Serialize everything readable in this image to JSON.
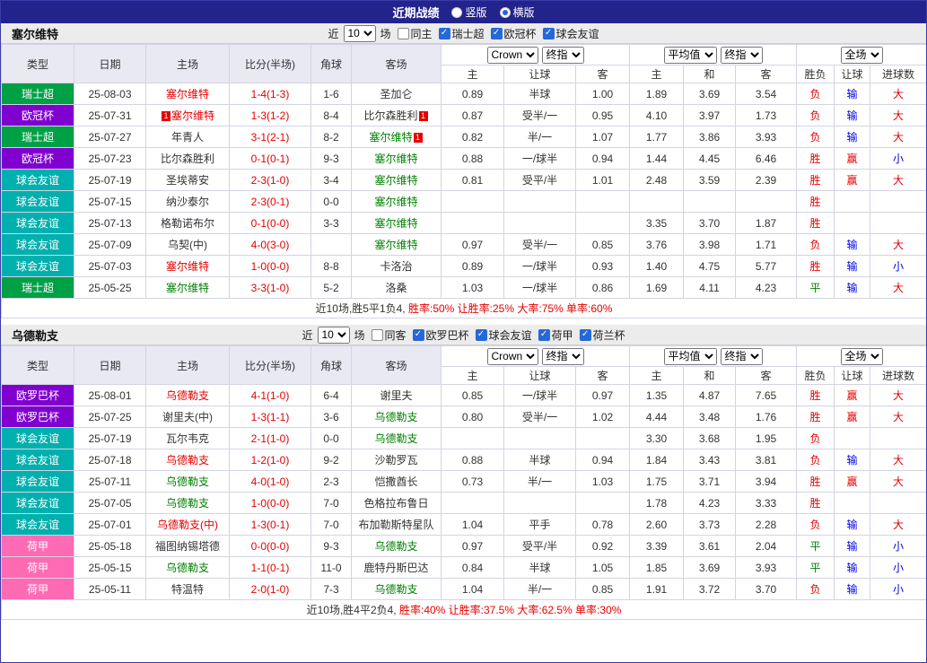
{
  "topbar": {
    "title": "近期战绩",
    "vertical_label": "竖版",
    "horizontal_label": "横版",
    "selected_label": "横版"
  },
  "filter_labels": {
    "near": "近",
    "games": "场"
  },
  "table_headers": {
    "type": "类型",
    "date": "日期",
    "home": "主场",
    "score": "比分(半场)",
    "corners": "角球",
    "away": "客场",
    "odds_header_groups": [
      {
        "selects": [
          "Crown",
          "终指"
        ]
      },
      {
        "selects": [
          "平均值",
          "终指"
        ]
      },
      {
        "selects": [
          "全场"
        ]
      }
    ],
    "sub_headers": [
      "主",
      "让球",
      "客",
      "主",
      "和",
      "客",
      "胜负",
      "让球",
      "进球数"
    ]
  },
  "league_colors": {
    "瑞士超": "#00a046",
    "欧冠杯": "#8000d0",
    "球会友谊": "#00b0ae",
    "欧罗巴杯": "#8000d0",
    "荷甲": "#ff6ab5"
  },
  "colors": {
    "red": "#e60000",
    "green": "#008000",
    "blue": "#0000e6",
    "black": "#333333"
  },
  "sections": [
    {
      "team": "塞尔维特",
      "filter": {
        "count": "10",
        "same": {
          "label": "同主",
          "checked": false
        },
        "leagues": [
          {
            "label": "瑞士超",
            "checked": true
          },
          {
            "label": "欧冠杯",
            "checked": true
          },
          {
            "label": "球会友谊",
            "checked": true
          }
        ]
      },
      "rows": [
        {
          "league": "瑞士超",
          "date": "25-08-03",
          "home": {
            "name": "塞尔维特",
            "color": "red"
          },
          "score": "1-4(1-3)",
          "corners": "1-6",
          "away": {
            "name": "圣加仑",
            "color": "black"
          },
          "ah": [
            "0.89",
            "半球",
            "1.00"
          ],
          "avg": [
            "1.89",
            "3.69",
            "3.54"
          ],
          "res": [
            [
              "负",
              "red"
            ],
            [
              "输",
              "blue"
            ],
            [
              "大",
              "red"
            ]
          ]
        },
        {
          "league": "欧冠杯",
          "date": "25-07-31",
          "home": {
            "name": "塞尔维特",
            "color": "red",
            "badge": "1",
            "badge_pos": "before"
          },
          "score": "1-3(1-2)",
          "corners": "8-4",
          "away": {
            "name": "比尔森胜利",
            "color": "black",
            "badge": "1",
            "badge_pos": "after"
          },
          "ah": [
            "0.87",
            "受半/一",
            "0.95"
          ],
          "avg": [
            "4.10",
            "3.97",
            "1.73"
          ],
          "res": [
            [
              "负",
              "red"
            ],
            [
              "输",
              "blue"
            ],
            [
              "大",
              "red"
            ]
          ]
        },
        {
          "league": "瑞士超",
          "date": "25-07-27",
          "home": {
            "name": "年青人",
            "color": "black"
          },
          "score": "3-1(2-1)",
          "corners": "8-2",
          "away": {
            "name": "塞尔维特",
            "color": "green",
            "badge": "1",
            "badge_pos": "after"
          },
          "ah": [
            "0.82",
            "半/一",
            "1.07"
          ],
          "avg": [
            "1.77",
            "3.86",
            "3.93"
          ],
          "res": [
            [
              "负",
              "red"
            ],
            [
              "输",
              "blue"
            ],
            [
              "大",
              "red"
            ]
          ]
        },
        {
          "league": "欧冠杯",
          "date": "25-07-23",
          "home": {
            "name": "比尔森胜利",
            "color": "black"
          },
          "score": "0-1(0-1)",
          "corners": "9-3",
          "away": {
            "name": "塞尔维特",
            "color": "green"
          },
          "ah": [
            "0.88",
            "一/球半",
            "0.94"
          ],
          "avg": [
            "1.44",
            "4.45",
            "6.46"
          ],
          "res": [
            [
              "胜",
              "red"
            ],
            [
              "赢",
              "red"
            ],
            [
              "小",
              "blue"
            ]
          ]
        },
        {
          "league": "球会友谊",
          "date": "25-07-19",
          "home": {
            "name": "圣埃蒂安",
            "color": "black"
          },
          "score": "2-3(1-0)",
          "corners": "3-4",
          "away": {
            "name": "塞尔维特",
            "color": "green"
          },
          "ah": [
            "0.81",
            "受平/半",
            "1.01"
          ],
          "avg": [
            "2.48",
            "3.59",
            "2.39"
          ],
          "res": [
            [
              "胜",
              "red"
            ],
            [
              "赢",
              "red"
            ],
            [
              "大",
              "red"
            ]
          ]
        },
        {
          "league": "球会友谊",
          "date": "25-07-15",
          "home": {
            "name": "纳沙泰尔",
            "color": "black"
          },
          "score": "2-3(0-1)",
          "corners": "0-0",
          "away": {
            "name": "塞尔维特",
            "color": "green"
          },
          "ah": [
            "",
            "",
            ""
          ],
          "avg": [
            "",
            "",
            ""
          ],
          "res": [
            [
              "胜",
              "red"
            ],
            [
              "",
              "black"
            ],
            [
              "",
              "black"
            ]
          ]
        },
        {
          "league": "球会友谊",
          "date": "25-07-13",
          "home": {
            "name": "格勒诺布尔",
            "color": "black"
          },
          "score": "0-1(0-0)",
          "corners": "3-3",
          "away": {
            "name": "塞尔维特",
            "color": "green"
          },
          "ah": [
            "",
            "",
            ""
          ],
          "avg": [
            "3.35",
            "3.70",
            "1.87"
          ],
          "res": [
            [
              "胜",
              "red"
            ],
            [
              "",
              "black"
            ],
            [
              "",
              "black"
            ]
          ]
        },
        {
          "league": "球会友谊",
          "date": "25-07-09",
          "home": {
            "name": "乌契(中)",
            "color": "black"
          },
          "score": "4-0(3-0)",
          "corners": "",
          "away": {
            "name": "塞尔维特",
            "color": "green"
          },
          "ah": [
            "0.97",
            "受半/一",
            "0.85"
          ],
          "avg": [
            "3.76",
            "3.98",
            "1.71"
          ],
          "res": [
            [
              "负",
              "red"
            ],
            [
              "输",
              "blue"
            ],
            [
              "大",
              "red"
            ]
          ]
        },
        {
          "league": "球会友谊",
          "date": "25-07-03",
          "home": {
            "name": "塞尔维特",
            "color": "red"
          },
          "score": "1-0(0-0)",
          "corners": "8-8",
          "away": {
            "name": "卡洛治",
            "color": "black"
          },
          "ah": [
            "0.89",
            "一/球半",
            "0.93"
          ],
          "avg": [
            "1.40",
            "4.75",
            "5.77"
          ],
          "res": [
            [
              "胜",
              "red"
            ],
            [
              "输",
              "blue"
            ],
            [
              "小",
              "blue"
            ]
          ]
        },
        {
          "league": "瑞士超",
          "date": "25-05-25",
          "home": {
            "name": "塞尔维特",
            "color": "green"
          },
          "score": "3-3(1-0)",
          "corners": "5-2",
          "away": {
            "name": "洛桑",
            "color": "black"
          },
          "ah": [
            "1.03",
            "一/球半",
            "0.86"
          ],
          "avg": [
            "1.69",
            "4.11",
            "4.23"
          ],
          "res": [
            [
              "平",
              "green"
            ],
            [
              "输",
              "blue"
            ],
            [
              "大",
              "red"
            ]
          ]
        }
      ],
      "summary": {
        "black": "近10场,胜5平1负4,",
        "red": "胜率:50% 让胜率:25% 大率:75% 单率:60%"
      }
    },
    {
      "team": "乌德勒支",
      "filter": {
        "count": "10",
        "same": {
          "label": "同客",
          "checked": false
        },
        "leagues": [
          {
            "label": "欧罗巴杯",
            "checked": true
          },
          {
            "label": "球会友谊",
            "checked": true
          },
          {
            "label": "荷甲",
            "checked": true
          },
          {
            "label": "荷兰杯",
            "checked": true
          }
        ]
      },
      "rows": [
        {
          "league": "欧罗巴杯",
          "date": "25-08-01",
          "home": {
            "name": "乌德勒支",
            "color": "red"
          },
          "score": "4-1(1-0)",
          "corners": "6-4",
          "away": {
            "name": "谢里夫",
            "color": "black"
          },
          "ah": [
            "0.85",
            "一/球半",
            "0.97"
          ],
          "avg": [
            "1.35",
            "4.87",
            "7.65"
          ],
          "res": [
            [
              "胜",
              "red"
            ],
            [
              "赢",
              "red"
            ],
            [
              "大",
              "red"
            ]
          ]
        },
        {
          "league": "欧罗巴杯",
          "date": "25-07-25",
          "home": {
            "name": "谢里夫(中)",
            "color": "black"
          },
          "score": "1-3(1-1)",
          "corners": "3-6",
          "away": {
            "name": "乌德勒支",
            "color": "green"
          },
          "ah": [
            "0.80",
            "受半/一",
            "1.02"
          ],
          "avg": [
            "4.44",
            "3.48",
            "1.76"
          ],
          "res": [
            [
              "胜",
              "red"
            ],
            [
              "赢",
              "red"
            ],
            [
              "大",
              "red"
            ]
          ]
        },
        {
          "league": "球会友谊",
          "date": "25-07-19",
          "home": {
            "name": "瓦尔韦克",
            "color": "black"
          },
          "score": "2-1(1-0)",
          "corners": "0-0",
          "away": {
            "name": "乌德勒支",
            "color": "green"
          },
          "ah": [
            "",
            "",
            ""
          ],
          "avg": [
            "3.30",
            "3.68",
            "1.95"
          ],
          "res": [
            [
              "负",
              "red"
            ],
            [
              "",
              "black"
            ],
            [
              "",
              "black"
            ]
          ]
        },
        {
          "league": "球会友谊",
          "date": "25-07-18",
          "home": {
            "name": "乌德勒支",
            "color": "red"
          },
          "score": "1-2(1-0)",
          "corners": "9-2",
          "away": {
            "name": "沙勒罗瓦",
            "color": "black"
          },
          "ah": [
            "0.88",
            "半球",
            "0.94"
          ],
          "avg": [
            "1.84",
            "3.43",
            "3.81"
          ],
          "res": [
            [
              "负",
              "red"
            ],
            [
              "输",
              "blue"
            ],
            [
              "大",
              "red"
            ]
          ]
        },
        {
          "league": "球会友谊",
          "date": "25-07-11",
          "home": {
            "name": "乌德勒支",
            "color": "green"
          },
          "score": "4-0(1-0)",
          "corners": "2-3",
          "away": {
            "name": "恺撒酋长",
            "color": "black"
          },
          "ah": [
            "0.73",
            "半/一",
            "1.03"
          ],
          "avg": [
            "1.75",
            "3.71",
            "3.94"
          ],
          "res": [
            [
              "胜",
              "red"
            ],
            [
              "赢",
              "red"
            ],
            [
              "大",
              "red"
            ]
          ]
        },
        {
          "league": "球会友谊",
          "date": "25-07-05",
          "home": {
            "name": "乌德勒支",
            "color": "green"
          },
          "score": "1-0(0-0)",
          "corners": "7-0",
          "away": {
            "name": "色格拉布鲁日",
            "color": "black"
          },
          "ah": [
            "",
            "",
            ""
          ],
          "avg": [
            "1.78",
            "4.23",
            "3.33"
          ],
          "res": [
            [
              "胜",
              "red"
            ],
            [
              "",
              "black"
            ],
            [
              "",
              "black"
            ]
          ]
        },
        {
          "league": "球会友谊",
          "date": "25-07-01",
          "home": {
            "name": "乌德勒支(中)",
            "color": "red"
          },
          "score": "1-3(0-1)",
          "corners": "7-0",
          "away": {
            "name": "布加勒斯特星队",
            "color": "black"
          },
          "ah": [
            "1.04",
            "平手",
            "0.78"
          ],
          "avg": [
            "2.60",
            "3.73",
            "2.28"
          ],
          "res": [
            [
              "负",
              "red"
            ],
            [
              "输",
              "blue"
            ],
            [
              "大",
              "red"
            ]
          ]
        },
        {
          "league": "荷甲",
          "date": "25-05-18",
          "home": {
            "name": "福图纳锡塔德",
            "color": "black"
          },
          "score": "0-0(0-0)",
          "corners": "9-3",
          "away": {
            "name": "乌德勒支",
            "color": "green"
          },
          "ah": [
            "0.97",
            "受平/半",
            "0.92"
          ],
          "avg": [
            "3.39",
            "3.61",
            "2.04"
          ],
          "res": [
            [
              "平",
              "green"
            ],
            [
              "输",
              "blue"
            ],
            [
              "小",
              "blue"
            ]
          ]
        },
        {
          "league": "荷甲",
          "date": "25-05-15",
          "home": {
            "name": "乌德勒支",
            "color": "green"
          },
          "score": "1-1(0-1)",
          "corners": "11-0",
          "away": {
            "name": "鹿特丹斯巴达",
            "color": "black"
          },
          "ah": [
            "0.84",
            "半球",
            "1.05"
          ],
          "avg": [
            "1.85",
            "3.69",
            "3.93"
          ],
          "res": [
            [
              "平",
              "green"
            ],
            [
              "输",
              "blue"
            ],
            [
              "小",
              "blue"
            ]
          ]
        },
        {
          "league": "荷甲",
          "date": "25-05-11",
          "home": {
            "name": "特温特",
            "color": "black"
          },
          "score": "2-0(1-0)",
          "corners": "7-3",
          "away": {
            "name": "乌德勒支",
            "color": "green"
          },
          "ah": [
            "1.04",
            "半/一",
            "0.85"
          ],
          "avg": [
            "1.91",
            "3.72",
            "3.70"
          ],
          "res": [
            [
              "负",
              "red"
            ],
            [
              "输",
              "blue"
            ],
            [
              "小",
              "blue"
            ]
          ]
        }
      ],
      "summary": {
        "black": "近10场,胜4平2负4,",
        "red": "胜率:40% 让胜率:37.5% 大率:62.5% 单率:30%"
      }
    }
  ]
}
